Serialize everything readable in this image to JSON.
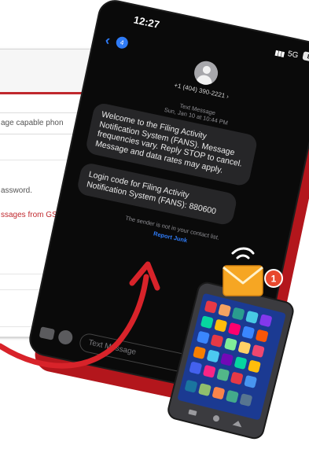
{
  "background_form": {
    "text_capable": "age capable phon",
    "text_password": "assword.",
    "text_messages": "ssages from GS"
  },
  "phone": {
    "time": "12:27",
    "signal": "▮▮▮",
    "network": "5G",
    "battery": "82",
    "back_count": "4",
    "contact_number": "+1 (404) 390-2221 ›",
    "meta_type": "Text Message",
    "meta_date": "Sun, Jan 10 at 10:44 PM",
    "messages": [
      "Welcome to the Filing Activity Notification System (FANS). Message frequencies vary. Reply STOP to cancel. Message and data rates may apply.",
      "Login code for Filing Activity Notification System (FANS): 880600"
    ],
    "notice": "The sender is not in your contact list.",
    "report": "Report Junk",
    "composer_placeholder": "Text Message"
  },
  "notification": {
    "badge_count": "1"
  },
  "icons": [
    "back-chevron-icon",
    "contact-avatar-icon",
    "camera-icon",
    "app-store-icon",
    "envelope-icon",
    "wifi-icon"
  ],
  "colors": {
    "accent_red": "#c0282d",
    "ios_blue": "#2f7bf6",
    "bubble_gray": "#262628",
    "envelope_orange": "#f6a623"
  }
}
